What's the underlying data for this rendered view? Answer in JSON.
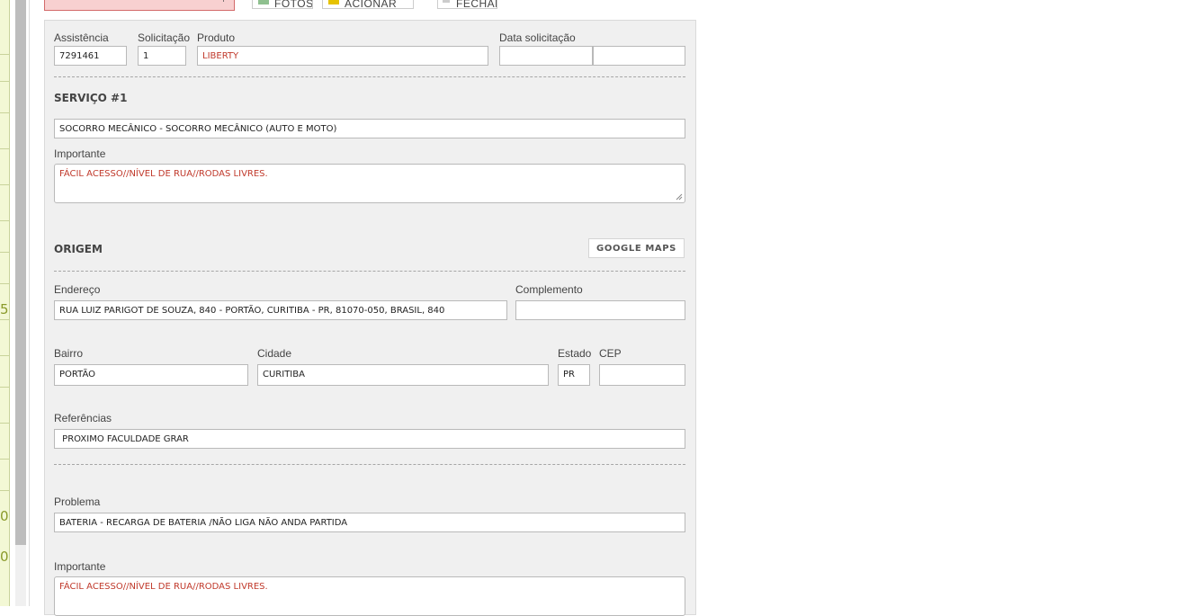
{
  "toolbar": {
    "photos_label": "FOTOS",
    "chat_label": "ACIONAR CHAT",
    "close_label": "FECHAR"
  },
  "left_strip": {
    "nums": [
      "5",
      "0",
      "0"
    ]
  },
  "form": {
    "assistencia": {
      "label": "Assistência",
      "value": "7291461"
    },
    "solicitacao": {
      "label": "Solicitação",
      "value": "1"
    },
    "produto": {
      "label": "Produto",
      "value": "LIBERTY"
    },
    "data_solicitacao": {
      "label": "Data solicitação",
      "date": "",
      "time": ""
    },
    "servico": {
      "title": "SERVIÇO #1",
      "value": "SOCORRO MECÂNICO - SOCORRO MECÂNICO (AUTO E MOTO)",
      "importante_label": "Importante",
      "importante_value": "FÁCIL ACESSO//NÍVEL DE RUA//RODAS LIVRES."
    },
    "origem": {
      "title": "ORIGEM",
      "maps_button": "GOOGLE MAPS",
      "endereco": {
        "label": "Endereço",
        "value": "RUA LUIZ PARIGOT DE SOUZA, 840 - PORTÃO, CURITIBA - PR, 81070-050, BRASIL, 840"
      },
      "complemento": {
        "label": "Complemento",
        "value": ""
      },
      "bairro": {
        "label": "Bairro",
        "value": "PORTÃO"
      },
      "cidade": {
        "label": "Cidade",
        "value": "CURITIBA"
      },
      "estado": {
        "label": "Estado",
        "value": "PR"
      },
      "cep": {
        "label": "CEP",
        "value": ""
      },
      "referencias": {
        "label": "Referências",
        "value": " PROXIMO FACULDADE GRAR"
      }
    },
    "problema": {
      "label": "Problema",
      "value": "BATERIA - RECARGA DE BATERIA /NÃO LIGA NÃO ANDA PARTIDA"
    },
    "importante2": {
      "label": "Importante",
      "value": "FÁCIL ACESSO//NÍVEL DE RUA//RODAS LIVRES."
    }
  }
}
